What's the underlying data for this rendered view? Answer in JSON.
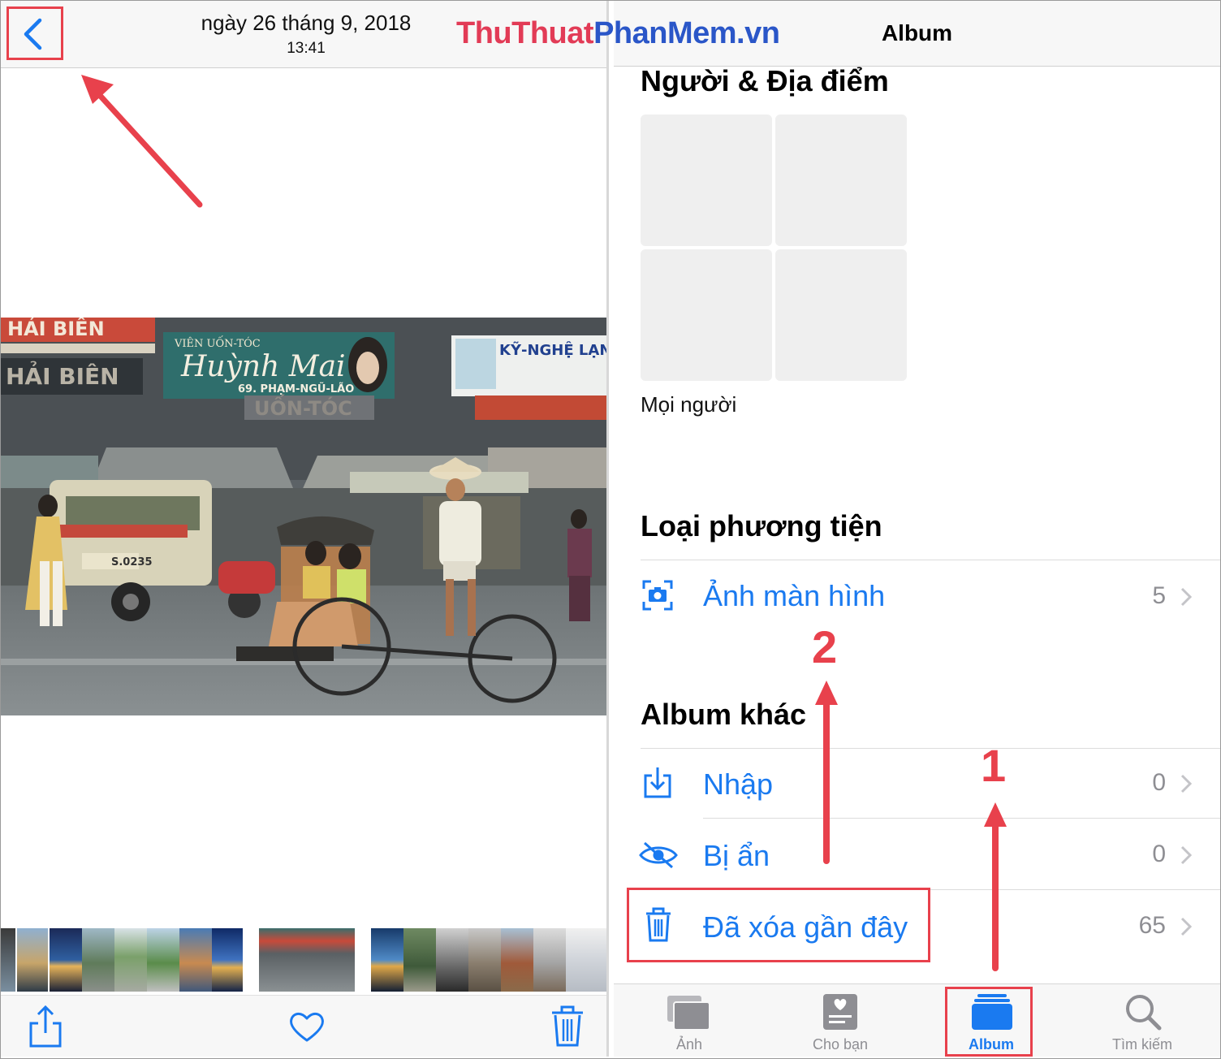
{
  "watermark": {
    "part1": "ThuThuat",
    "part2": "PhanMem",
    "part3": ".vn"
  },
  "left": {
    "date": "ngày 26 tháng 9, 2018",
    "time": "13:41",
    "photo_signs": {
      "sign1": "VIÊN UỐN-TÓC",
      "sign2": "Huỳnh Mai",
      "sign3": "69. PHẠM-NGŨ-LÃO",
      "sign4": "KỸ-NGHỆ LẠNH",
      "sign5": "HẢI BIÊN",
      "sign6": "UỐN-TÓC",
      "plate": "S.0235"
    }
  },
  "right": {
    "title": "Album",
    "section_people": "Người & Địa điểm",
    "people_caption": "Mọi người",
    "section_media": "Loại phương tiện",
    "section_other": "Album khác",
    "rows": [
      {
        "label": "Ảnh màn hình",
        "count": "5",
        "icon": "screenshot-icon"
      },
      {
        "label": "Nhập",
        "count": "0",
        "icon": "import-icon"
      },
      {
        "label": "Bị ẩn",
        "count": "0",
        "icon": "hidden-eye-icon"
      },
      {
        "label": "Đã xóa gần đây",
        "count": "65",
        "icon": "trash-icon"
      }
    ],
    "tabs": [
      {
        "label": "Ảnh",
        "icon": "photos-icon",
        "active": false
      },
      {
        "label": "Cho bạn",
        "icon": "for-you-icon",
        "active": false
      },
      {
        "label": "Album",
        "icon": "album-icon",
        "active": true
      },
      {
        "label": "Tìm kiếm",
        "icon": "search-icon",
        "active": false
      }
    ]
  },
  "annotations": {
    "step1": "1",
    "step2": "2"
  },
  "colors": {
    "accent": "#1a7af0",
    "highlight": "#e8414c",
    "gray": "#8e8e93"
  }
}
